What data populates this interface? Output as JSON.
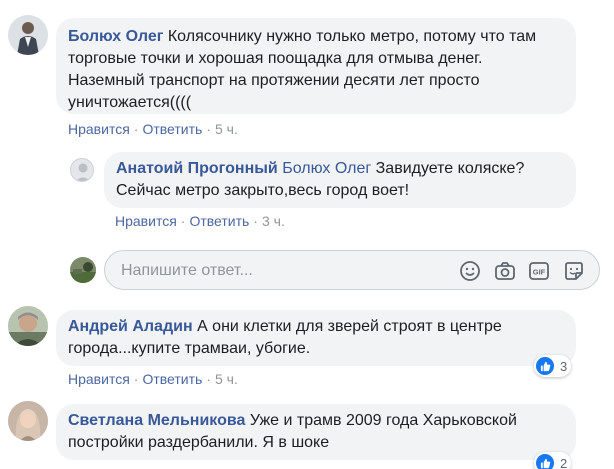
{
  "comments": [
    {
      "author": "Болюх Олег",
      "lines": [
        "Колясочнику нужно только метро, потому что там",
        "торговые точки и хорошая поощадка для отмыва денег.",
        "Наземный транспорт на протяжении десяти лет просто",
        "уничтожается(((("
      ],
      "actions": {
        "like": "Нравится",
        "reply": "Ответить",
        "time": "5 ч."
      }
    },
    {
      "author": "Анатоий Прогонный",
      "mention": "Болюх Олег",
      "lines": [
        "Завидуете коляске?",
        "Сейчас метро закрыто,весь город воет!"
      ],
      "actions": {
        "like": "Нравится",
        "reply": "Ответить",
        "time": "3 ч."
      }
    },
    {
      "author": "Андрей Аладин",
      "lines": [
        "А они клетки для зверей строят в центре",
        "города...купите трамваи, убогие."
      ],
      "actions": {
        "like": "Нравится",
        "reply": "Ответить",
        "time": "5 ч."
      },
      "reactions": "3"
    },
    {
      "author": "Светлана Мельникова",
      "lines": [
        "Уже и трамв 2009 года Харьковской",
        "постройки раздербанили. Я в шоке"
      ],
      "reactions": "2"
    }
  ],
  "reply": {
    "placeholder": "Напишите ответ...",
    "icons": [
      "emoji-icon",
      "camera-icon",
      "gif-icon",
      "sticker-icon"
    ]
  },
  "colors": {
    "link": "#385898",
    "bubble": "#f2f3f5",
    "like": "#1877f2"
  }
}
